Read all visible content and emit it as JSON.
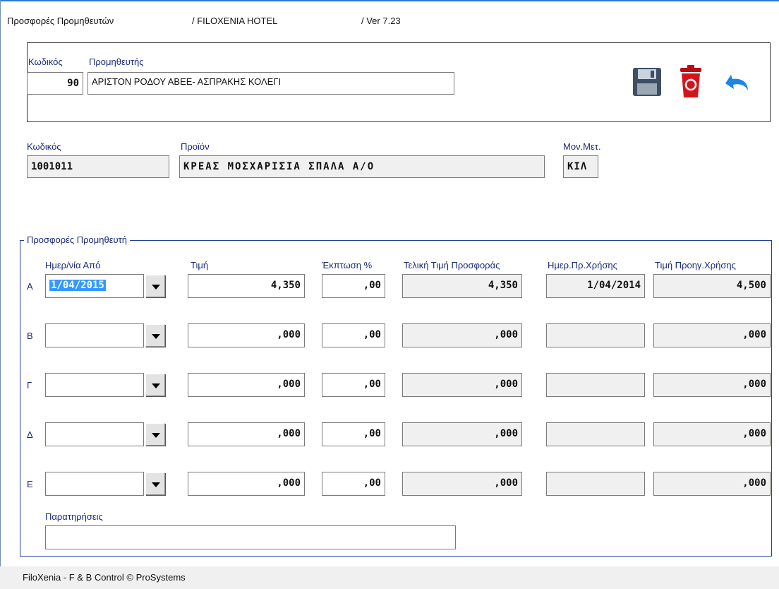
{
  "header": {
    "screen_title": "Προσφορές Προμηθευτών",
    "hotel": "/ FILOXENIA HOTEL",
    "version": "/ Ver  7.23"
  },
  "supplier": {
    "code_label": "Κωδικός",
    "name_label": "Προμηθευτής",
    "code": "90",
    "name": "ΑΡΙΣΤΟΝ ΡΟΔΟΥ ΑΒΕΕ- ΑΣΠΡΑΚΗΣ ΚΟΛΕΓΙ"
  },
  "toolbar": {
    "save_icon": "floppy-disk-icon",
    "delete_icon": "recycle-bin-icon",
    "undo_icon": "undo-arrow-icon"
  },
  "product": {
    "code_label": "Κωδικός",
    "name_label": "Προϊόν",
    "unit_label": "Μον.Μετ.",
    "code": "1001011",
    "name": "ΚΡΕΑΣ ΜΟΣΧΑΡΙΣΙΑ ΣΠΑΛΑ Α/Ο",
    "unit": "ΚΙΛ"
  },
  "offers": {
    "legend": "Προσφορές Προμηθευτή",
    "columns": {
      "date_from": "Ημερ/νία Από",
      "price": "Τιμή",
      "discount": "Έκπτωση %",
      "final_price": "Τελική Τιμή Προσφοράς",
      "prev_use_date": "Ημερ.Πρ.Χρήσης",
      "prev_use_price": "Τιμή Προηγ.Χρήσης"
    },
    "rows": [
      {
        "label": "Α",
        "date": "1/04/2015",
        "price": "4,350",
        "discount": ",00",
        "final": "4,350",
        "prev_date": "1/04/2014",
        "prev_price": "4,500"
      },
      {
        "label": "Β",
        "date": "",
        "price": ",000",
        "discount": ",00",
        "final": ",000",
        "prev_date": "",
        "prev_price": ",000"
      },
      {
        "label": "Γ",
        "date": "",
        "price": ",000",
        "discount": ",00",
        "final": ",000",
        "prev_date": "",
        "prev_price": ",000"
      },
      {
        "label": "Δ",
        "date": "",
        "price": ",000",
        "discount": ",00",
        "final": ",000",
        "prev_date": "",
        "prev_price": ",000"
      },
      {
        "label": "Ε",
        "date": "",
        "price": ",000",
        "discount": ",00",
        "final": ",000",
        "prev_date": "",
        "prev_price": ",000"
      }
    ],
    "remarks_label": "Παρατηρήσεις",
    "remarks_value": ""
  },
  "footer": {
    "text": "FiloXenia - F & B Control © ProSystems"
  },
  "colors": {
    "label_text": "#1a2a7a",
    "frame_border": "#1f3f96",
    "selection": "#3399ff",
    "title_bar_line": "#2b79d4"
  }
}
